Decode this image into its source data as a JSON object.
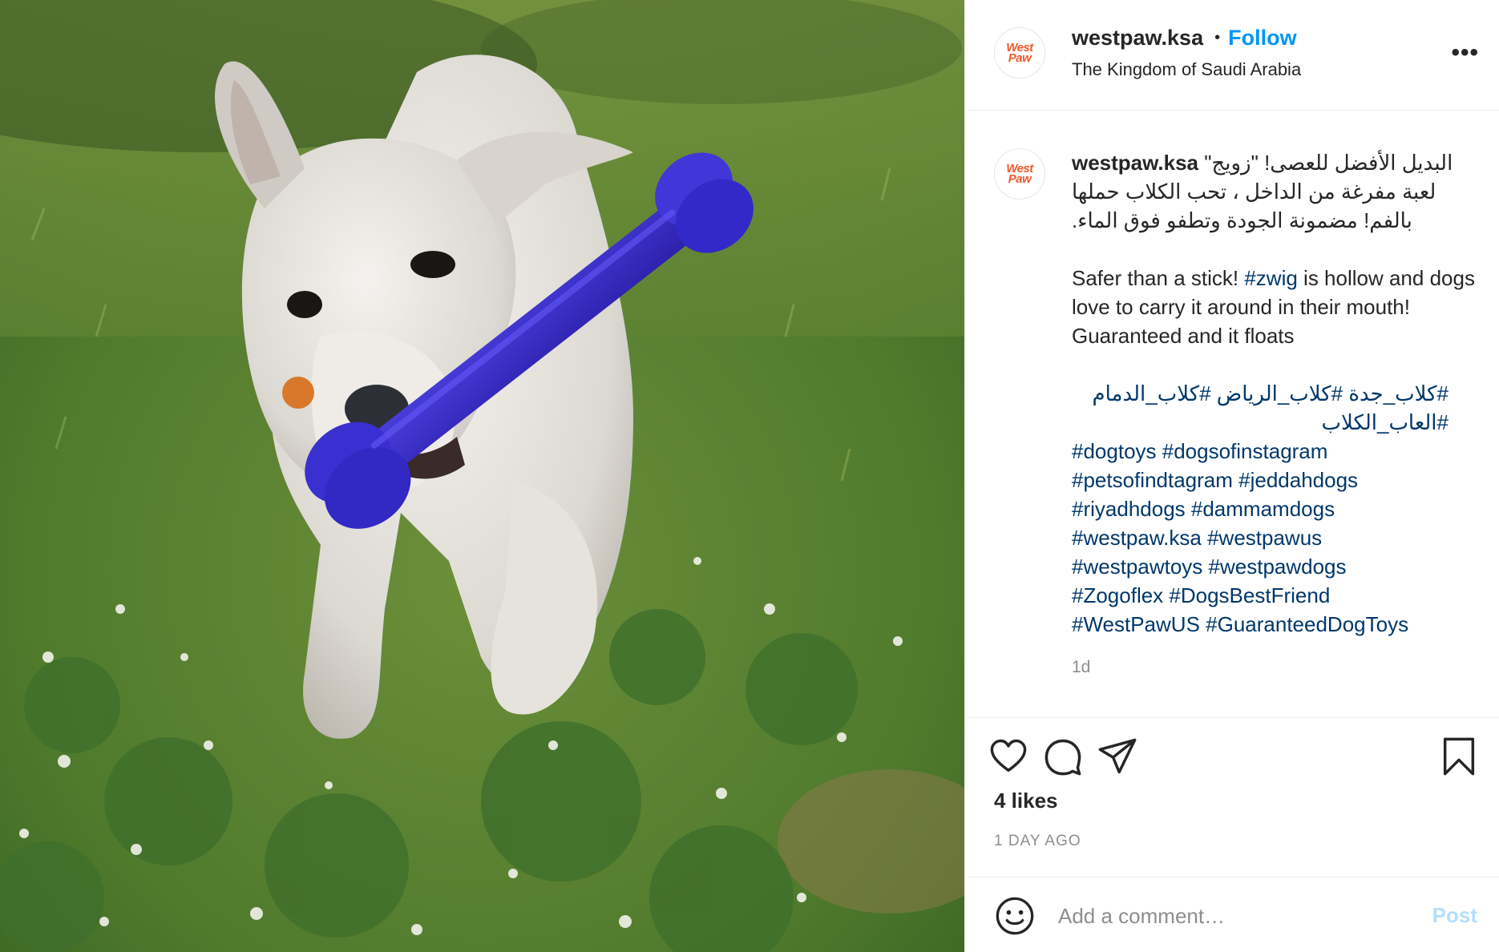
{
  "post": {
    "username": "westpaw.ksa",
    "separator": "•",
    "follow_label": "Follow",
    "location": "The Kingdom of Saudi Arabia",
    "more_label": "•••",
    "avatar_logo_line1": "West",
    "avatar_logo_line2": "Paw"
  },
  "caption": {
    "username": "westpaw.ksa",
    "arabic_text": "البديل الأفضل للعصى! \"زويج\" لعبة مفرغة من الداخل ، تحب الكلاب حملها بالفم! مضمونة الجودة وتطفو فوق الماء.",
    "english_prefix": "Safer than a stick! ",
    "english_tag": "#zwig",
    "english_suffix": " is hollow and dogs love to carry it around in their mouth! Guaranteed and it floats",
    "arabic_tags": "#كلاب_جدة #كلاب_الرياض #كلاب_الدمام #العاب_الكلاب",
    "tag_lines": [
      "#dogtoys #dogsofinstagram",
      "#petsofindtagram #jeddahdogs",
      "#riyadhdogs #dammamdogs",
      "#westpaw.ksa #westpawus",
      "#westpawtoys #westpawdogs",
      "#Zogoflex #DogsBestFriend",
      "#WestPawUS #GuaranteedDogToys"
    ],
    "time": "1d"
  },
  "actions": {
    "icons": [
      "heart-icon",
      "comment-icon",
      "share-icon",
      "bookmark-icon"
    ],
    "likes": "4 likes",
    "posted_ago": "1 DAY AGO"
  },
  "comment": {
    "placeholder": "Add a comment…",
    "post_label": "Post",
    "emoji_icon": "smiley-icon"
  },
  "colors": {
    "link_blue": "#0095f6",
    "hashtag": "#00376b",
    "post_disabled": "#b2dffc",
    "brand_orange": "#ef5a2b",
    "toy_purple": "#3b2fc0"
  }
}
